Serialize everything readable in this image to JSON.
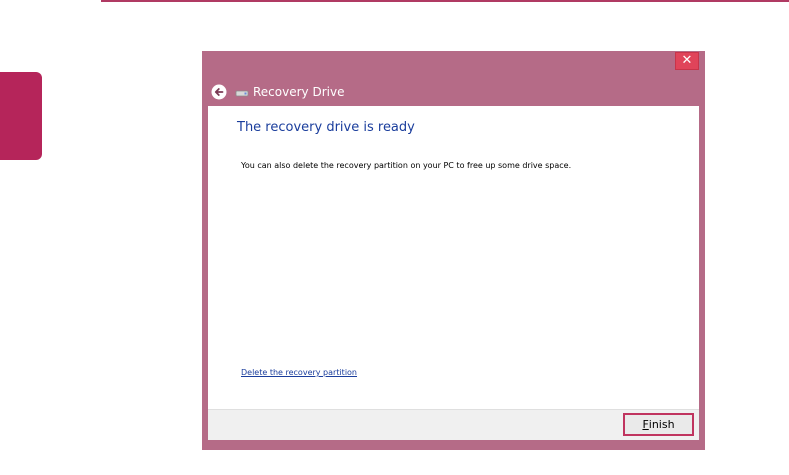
{
  "colors": {
    "accent_magenta": "#b03a63",
    "side_tab": "#b5255a",
    "window_frame": "#b56b87",
    "close_button": "#e0445a",
    "heading_blue": "#1a3d9c",
    "link_blue": "#1a3d9c",
    "highlight_border": "#c0345f"
  },
  "window": {
    "title": "Recovery Drive",
    "close_symbol": "✕",
    "icons": [
      "back-arrow-icon",
      "drive-icon"
    ]
  },
  "content": {
    "heading": "The recovery drive is ready",
    "body": "You can also delete the recovery partition on your PC to free up some drive space.",
    "link": "Delete the recovery partition"
  },
  "footer": {
    "finish_accel": "F",
    "finish_rest": "inish"
  }
}
